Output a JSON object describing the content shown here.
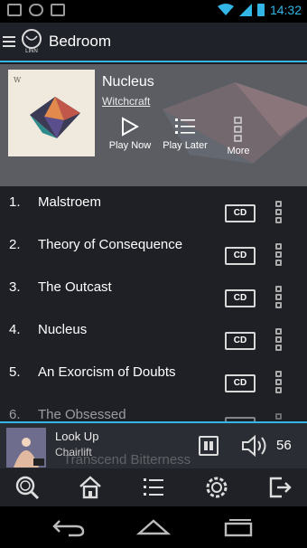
{
  "status_bar": {
    "time": "14:32",
    "accent": "#33b5e5"
  },
  "action_bar": {
    "logo_text": "LINN",
    "room": "Bedroom"
  },
  "album": {
    "title": "Nucleus",
    "artist": "Witchcraft",
    "actions": {
      "play_now": "Play Now",
      "play_later": "Play Later",
      "more": "More"
    }
  },
  "tracks": [
    {
      "number": "1.",
      "title": "Malstroem",
      "source": "CD"
    },
    {
      "number": "2.",
      "title": "Theory of Consequence",
      "source": "CD"
    },
    {
      "number": "3.",
      "title": "The Outcast",
      "source": "CD"
    },
    {
      "number": "4.",
      "title": "Nucleus",
      "source": "CD"
    },
    {
      "number": "5.",
      "title": "An Exorcism of Doubts",
      "source": "CD"
    },
    {
      "number": "6.",
      "title": "The Obsessed",
      "source": "CD"
    }
  ],
  "mini_player": {
    "title": "Look Up",
    "artist": "Chairlift",
    "ghost_text": "Transcend Bitterness",
    "volume": "56"
  },
  "tabs": [
    "search-icon",
    "home-icon",
    "playlist-icon",
    "settings-icon",
    "exit-icon"
  ],
  "nav": [
    "back-icon",
    "home-nav-icon",
    "recents-icon"
  ]
}
